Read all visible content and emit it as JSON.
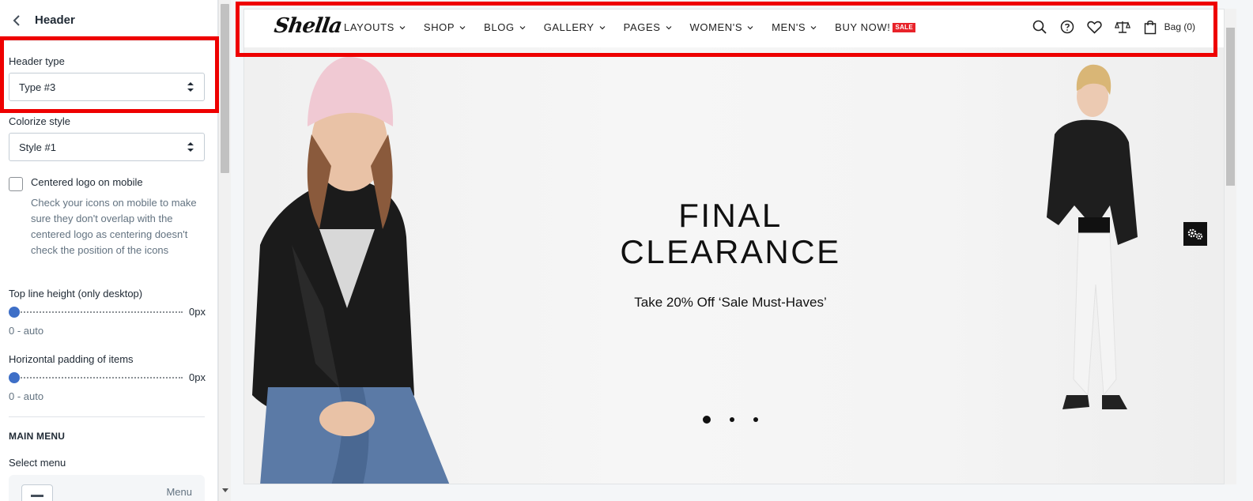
{
  "panel": {
    "back_label": "Header",
    "header_type": {
      "label": "Header type",
      "value": "Type #3"
    },
    "colorize": {
      "label": "Colorize style",
      "value": "Style #1"
    },
    "centered_logo": {
      "label": "Centered logo on mobile",
      "checked": false,
      "help": "Check your icons on mobile to make sure they don't overlap with the centered logo as centering doesn't check the position of the icons"
    },
    "top_line": {
      "label": "Top line height (only desktop)",
      "value": "0px",
      "help": "0 - auto",
      "level": 0
    },
    "h_padding": {
      "label": "Horizontal padding of items",
      "value": "0px",
      "help": "0 - auto",
      "level": 0
    },
    "main_menu_heading": "MAIN MENU",
    "select_menu_label": "Select menu",
    "menu_card_text": "Menu"
  },
  "site": {
    "logo": "Shella",
    "nav": [
      {
        "label": "LAYOUTS"
      },
      {
        "label": "SHOP"
      },
      {
        "label": "BLOG"
      },
      {
        "label": "GALLERY"
      },
      {
        "label": "PAGES"
      },
      {
        "label": "WOMEN'S"
      },
      {
        "label": "MEN'S"
      }
    ],
    "buy_now": "BUY NOW!",
    "sale_badge": "SALE",
    "bag_label": "Bag (0)",
    "icons": [
      "search-icon",
      "help-icon",
      "heart-icon",
      "compare-icon",
      "bag-icon"
    ]
  },
  "hero": {
    "title_line1": "FINAL",
    "title_line2": "CLEARANCE",
    "subtitle": "Take 20% Off ‘Sale Must-Haves’",
    "slides": 3,
    "active_slide": 1
  },
  "colors": {
    "accent": "#3e6fc7",
    "sale": "#e8232a",
    "highlight": "#ee0000"
  }
}
